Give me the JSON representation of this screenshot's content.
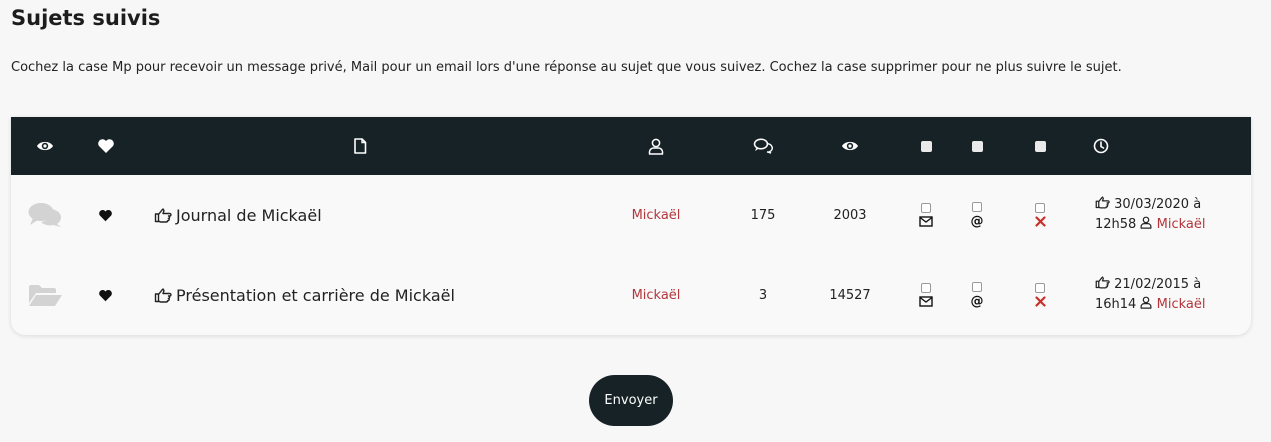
{
  "page": {
    "title": "Sujets suivis",
    "intro": "Cochez la case Mp pour recevoir un message privé, Mail pour un email lors d'une réponse au sujet que vous suivez. Cochez la case supprimer pour ne plus suivre le sujet."
  },
  "table": {
    "header_icons": [
      "eye-icon",
      "heart-icon",
      "file-icon",
      "user-icon",
      "comments-icon",
      "eye-icon",
      "square-icon",
      "square-icon",
      "square-icon",
      "clock-icon"
    ],
    "rows": [
      {
        "status_icon": "comments-icon",
        "favorite_icon": "heart-icon",
        "topic": "Journal de Mickaël",
        "author": "Mickaël",
        "replies": "175",
        "views": "2003",
        "last_post_date": "30/03/2020 à",
        "last_post_time": "12h58",
        "last_post_user": "Mickaël"
      },
      {
        "status_icon": "folder-open-icon",
        "favorite_icon": "heart-icon",
        "topic": "Présentation et carrière de Mickaël",
        "author": "Mickaël",
        "replies": "3",
        "views": "14527",
        "last_post_date": "21/02/2015 à",
        "last_post_time": "16h14",
        "last_post_user": "Mickaël"
      }
    ],
    "options": {
      "mp_icon": "envelope-icon",
      "mail_symbol": "@",
      "delete_icon": "close-icon",
      "delete_color": "#c9302c"
    }
  },
  "form": {
    "submit_label": "Envoyer"
  },
  "colors": {
    "header_bg": "#172226",
    "link": "#b3363b",
    "button_bg": "#172226"
  }
}
